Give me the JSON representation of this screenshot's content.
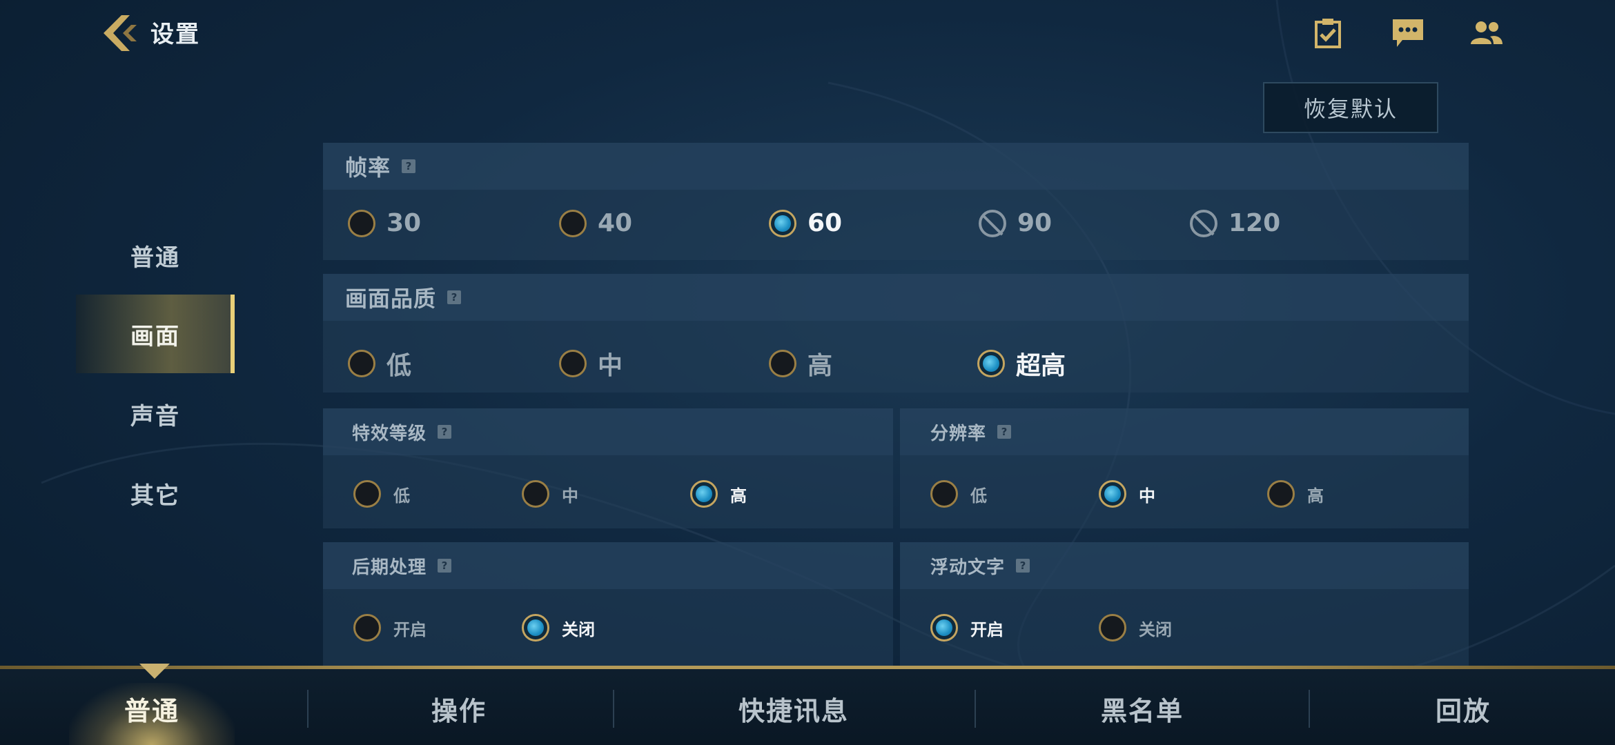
{
  "header": {
    "title": "设置",
    "reset_label": "恢复默认"
  },
  "sidebar": {
    "items": [
      {
        "label": "普通",
        "active": false
      },
      {
        "label": "画面",
        "active": true
      },
      {
        "label": "声音",
        "active": false
      },
      {
        "label": "其它",
        "active": false
      }
    ]
  },
  "frame_rate": {
    "title": "帧率",
    "options": [
      {
        "label": "30",
        "state": "off"
      },
      {
        "label": "40",
        "state": "off"
      },
      {
        "label": "60",
        "state": "on"
      },
      {
        "label": "90",
        "state": "disabled"
      },
      {
        "label": "120",
        "state": "disabled"
      }
    ]
  },
  "quality": {
    "title": "画面品质",
    "options": [
      {
        "label": "低",
        "state": "off"
      },
      {
        "label": "中",
        "state": "off"
      },
      {
        "label": "高",
        "state": "off"
      },
      {
        "label": "超高",
        "state": "on"
      }
    ]
  },
  "effects": {
    "title": "特效等级",
    "options": [
      {
        "label": "低",
        "state": "off"
      },
      {
        "label": "中",
        "state": "off"
      },
      {
        "label": "高",
        "state": "on"
      }
    ]
  },
  "resolution": {
    "title": "分辨率",
    "options": [
      {
        "label": "低",
        "state": "off"
      },
      {
        "label": "中",
        "state": "on"
      },
      {
        "label": "高",
        "state": "off"
      }
    ]
  },
  "post_processing": {
    "title": "后期处理",
    "options": [
      {
        "label": "开启",
        "state": "off"
      },
      {
        "label": "关闭",
        "state": "on"
      }
    ]
  },
  "floating_text": {
    "title": "浮动文字",
    "options": [
      {
        "label": "开启",
        "state": "on"
      },
      {
        "label": "关闭",
        "state": "off"
      }
    ]
  },
  "bottom_tabs": [
    {
      "label": "普通",
      "active": true
    },
    {
      "label": "操作",
      "active": false
    },
    {
      "label": "快捷讯息",
      "active": false
    },
    {
      "label": "黑名单",
      "active": false
    },
    {
      "label": "回放",
      "active": false
    }
  ],
  "icons": {
    "back": "back-chevron-icon",
    "missions": "clipboard-check-icon",
    "chat": "chat-bubble-icon",
    "friends": "friends-icon",
    "help": "help-icon"
  },
  "colors": {
    "accent_gold": "#c4a560",
    "radio_blue": "#1c8fc4",
    "bg": "#102840"
  }
}
